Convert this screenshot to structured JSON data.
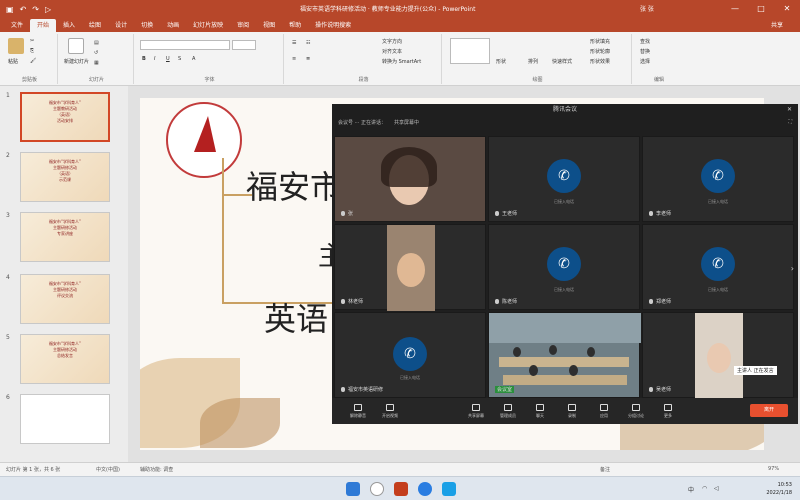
{
  "titlebar": {
    "document_title": "福安市英语学科研修活动  ·  教师专业能力提升(公众) - PowerPoint",
    "user": "张  张",
    "min": "—",
    "max": "□",
    "close": "✕"
  },
  "tabs": [
    "文件",
    "开始",
    "插入",
    "绘图",
    "设计",
    "切换",
    "动画",
    "幻灯片放映",
    "审阅",
    "视图",
    "帮助",
    "操作说明搜索"
  ],
  "share_label": "共享",
  "ribbon": {
    "paste": "粘贴",
    "clipboard": "剪贴板",
    "new_slide": "新建幻灯片",
    "slides_group": "幻灯片",
    "font_group": "字体",
    "paragraph_group": "段落",
    "drawing_group": "绘图",
    "editing_group": "编辑",
    "find": "查找",
    "replace": "替换",
    "select": "选择",
    "text_direction": "文字方向",
    "align_text": "对齐文本",
    "convert_smartart": "转换为 SmartArt",
    "shapes": "形状",
    "arrange": "排列",
    "quick_styles": "快速样式",
    "shape_fill": "形状填充",
    "shape_outline": "形状轮廓",
    "shape_effects": "形状效果"
  },
  "slides": [
    {
      "num": "1",
      "lines": [
        "福安市“学科育人”",
        "主题教研活动",
        "（英语）",
        "活动安排"
      ]
    },
    {
      "num": "2",
      "lines": [
        "福安市“学科育人”",
        "主题研修活动",
        "（英语）",
        "示范课"
      ]
    },
    {
      "num": "3",
      "lines": [
        "福安市“学科育人”",
        "主题研修活动",
        "专家讲座"
      ]
    },
    {
      "num": "4",
      "lines": [
        "福安市“学科育人”",
        "主题研修活动",
        "评议交流"
      ]
    },
    {
      "num": "5",
      "lines": [
        "福安市“学科育人”",
        "主题研修活动",
        "总结发言"
      ]
    },
    {
      "num": "6",
      "lines": []
    }
  ],
  "slide_main": {
    "title_line1": "福安市",
    "title_line2": "主",
    "title_line3": "英语"
  },
  "meeting": {
    "window_title": "腾讯会议",
    "close": "✕",
    "toolbar_info": "会议号 ··· 正在讲话：",
    "recording": "共享屏幕中",
    "fullscreen": "⛶",
    "participants": [
      {
        "name": "张",
        "type": "video",
        "sub": ""
      },
      {
        "name": "王老师",
        "type": "phone",
        "sub": "已接入电话"
      },
      {
        "name": "李老师",
        "type": "phone",
        "sub": "已接入电话"
      },
      {
        "name": "林老师",
        "type": "video",
        "sub": ""
      },
      {
        "name": "陈老师",
        "type": "phone",
        "sub": "已接入电话"
      },
      {
        "name": "郑老师",
        "type": "phone",
        "sub": "已接入电话"
      },
      {
        "name": "福安市英语研修",
        "type": "phone",
        "sub": "已接入电话"
      },
      {
        "name": "会议室",
        "type": "video",
        "sub": ""
      },
      {
        "name": "吴老师",
        "type": "video",
        "sub": ""
      }
    ],
    "controls": [
      "解除静音",
      "开启视频",
      "共享屏幕",
      "管理成员",
      "聊天",
      "录制",
      "应用",
      "分组讨论",
      "更多"
    ],
    "leave": "离开",
    "speaker_caption": "主讲人  正在发言"
  },
  "status": {
    "slide_info": "幻灯片 第 1 张，共 6 张",
    "language": "中文(中国)",
    "accessibility": "辅助功能: 调查",
    "notes": "备注",
    "zoom": "97%"
  },
  "taskbar": {
    "time": "10:53",
    "date": "2022/1/18",
    "lang": "中"
  },
  "colors": {
    "ppt_brand": "#b7472a",
    "meeting_bg": "#1f1f1f",
    "phone_icon": "#0d4f8a",
    "leave_button": "#e8502f",
    "accent_gold": "#c9a062"
  }
}
